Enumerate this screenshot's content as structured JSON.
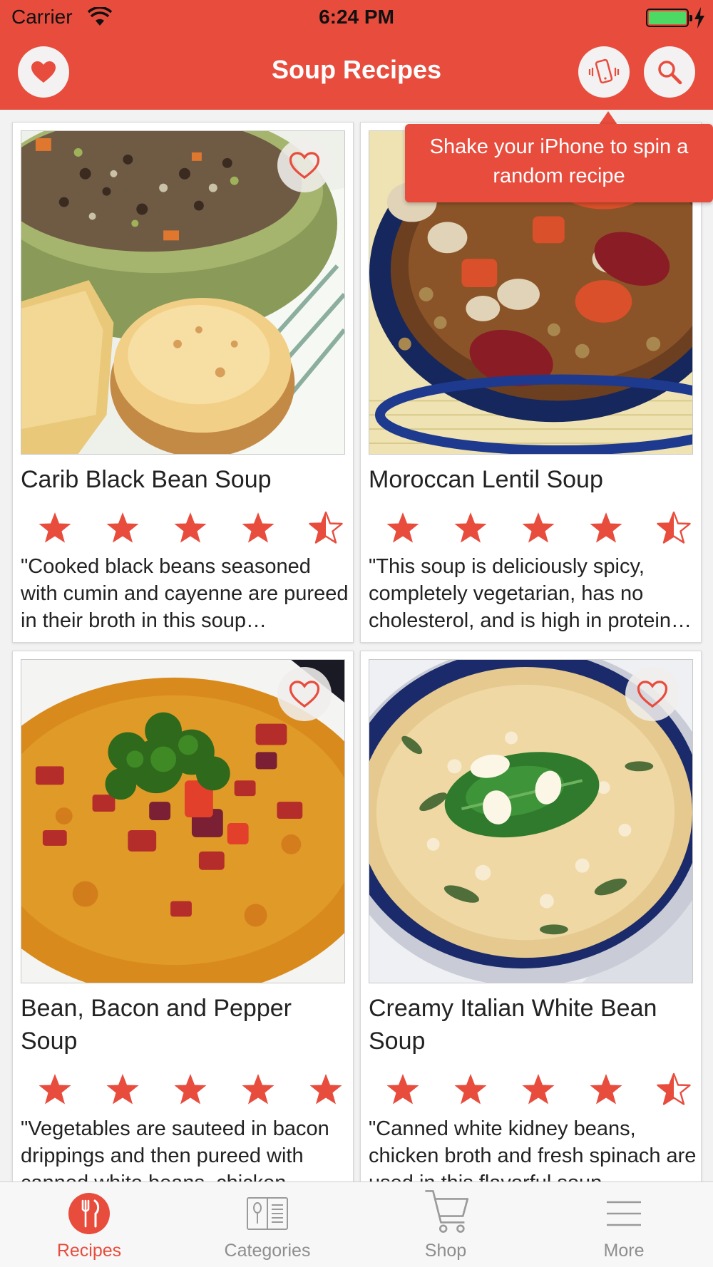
{
  "status_bar": {
    "carrier": "Carrier",
    "time": "6:24 PM",
    "battery_level": 1.0
  },
  "header": {
    "title": "Soup Recipes",
    "accent_color": "#e84c3d"
  },
  "tooltip": {
    "text": "Shake your iPhone to spin a random recipe"
  },
  "recipes": [
    {
      "title": "Carib Black Bean Soup",
      "rating": 4.5,
      "favorite": false,
      "description": "\"Cooked black beans seasoned with cumin and cayenne are pureed in their broth in this soup…"
    },
    {
      "title": "Moroccan Lentil Soup",
      "rating": 4.5,
      "favorite": false,
      "description": "\"This soup is deliciously spicy, completely vegetarian, has no cholesterol, and is high in protein…"
    },
    {
      "title": "Bean, Bacon and Pepper Soup",
      "rating": 5,
      "favorite": false,
      "description": "\"Vegetables are sauteed in bacon drippings and then pureed with canned white beans, chicken broth…"
    },
    {
      "title": "Creamy Italian White Bean Soup",
      "rating": 4.5,
      "favorite": false,
      "description": "\"Canned white kidney beans, chicken broth and fresh spinach are used in this flavorful soup…"
    }
  ],
  "tabs": [
    {
      "label": "Recipes",
      "icon": "fork-knife-icon",
      "active": true
    },
    {
      "label": "Categories",
      "icon": "recipe-book-icon",
      "active": false
    },
    {
      "label": "Shop",
      "icon": "shopping-cart-icon",
      "active": false
    },
    {
      "label": "More",
      "icon": "menu-icon",
      "active": false
    }
  ]
}
